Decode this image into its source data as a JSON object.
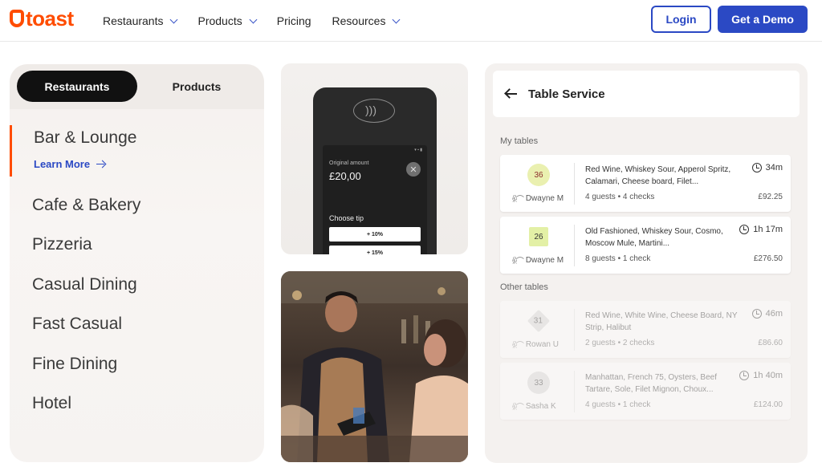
{
  "header": {
    "logo_text": "toast",
    "nav": [
      {
        "label": "Restaurants",
        "has_dropdown": true
      },
      {
        "label": "Products",
        "has_dropdown": true
      },
      {
        "label": "Pricing",
        "has_dropdown": false
      },
      {
        "label": "Resources",
        "has_dropdown": true
      }
    ],
    "login_label": "Login",
    "demo_label": "Get a Demo"
  },
  "segments_panel": {
    "toggle": {
      "active": "Restaurants",
      "inactive": "Products"
    },
    "active_segment": "Bar & Lounge",
    "learn_more": "Learn More",
    "segments": [
      "Cafe & Bakery",
      "Pizzeria",
      "Casual Dining",
      "Fast Casual",
      "Fine Dining",
      "Hotel"
    ]
  },
  "phone": {
    "original_label": "Original amount",
    "original_amount": "£20,00",
    "choose_tip": "Choose tip",
    "tip_options": [
      "+ 10%",
      "+ 15%"
    ]
  },
  "table_service": {
    "title": "Table Service",
    "my_tables_label": "My tables",
    "other_tables_label": "Other tables",
    "my_tables": [
      {
        "number": "36",
        "server": "Dwayne M",
        "items": "Red Wine, Whiskey Sour, Apperol Spritz, Calamari, Cheese board, Filet...",
        "time": "34m",
        "guests": "4 guests • 4 checks",
        "price": "£92.25",
        "badge_color": "#eaf0b0",
        "shape": "circle"
      },
      {
        "number": "26",
        "server": "Dwayne M",
        "items": "Old Fashioned, Whiskey Sour, Cosmo, Moscow Mule, Martini...",
        "time": "1h 17m",
        "guests": "8 guests • 1 check",
        "price": "£276.50",
        "badge_color": "#e3f0a6",
        "shape": "square"
      }
    ],
    "other_tables": [
      {
        "number": "31",
        "server": "Rowan U",
        "items": "Red Wine, White Wine, Cheese Board, NY Strip, Halibut",
        "time": "46m",
        "guests": "2 guests • 2 checks",
        "price": "£86.60",
        "badge_color": "#d6d6d6",
        "shape": "diamond"
      },
      {
        "number": "33",
        "server": "Sasha K",
        "items": "Manhattan, French 75, Oysters, Beef Tartare, Sole, Filet Mignon, Choux...",
        "time": "1h 40m",
        "guests": "4 guests • 1 check",
        "price": "£124.00",
        "badge_color": "#d6d6d6",
        "shape": "circle"
      }
    ]
  }
}
